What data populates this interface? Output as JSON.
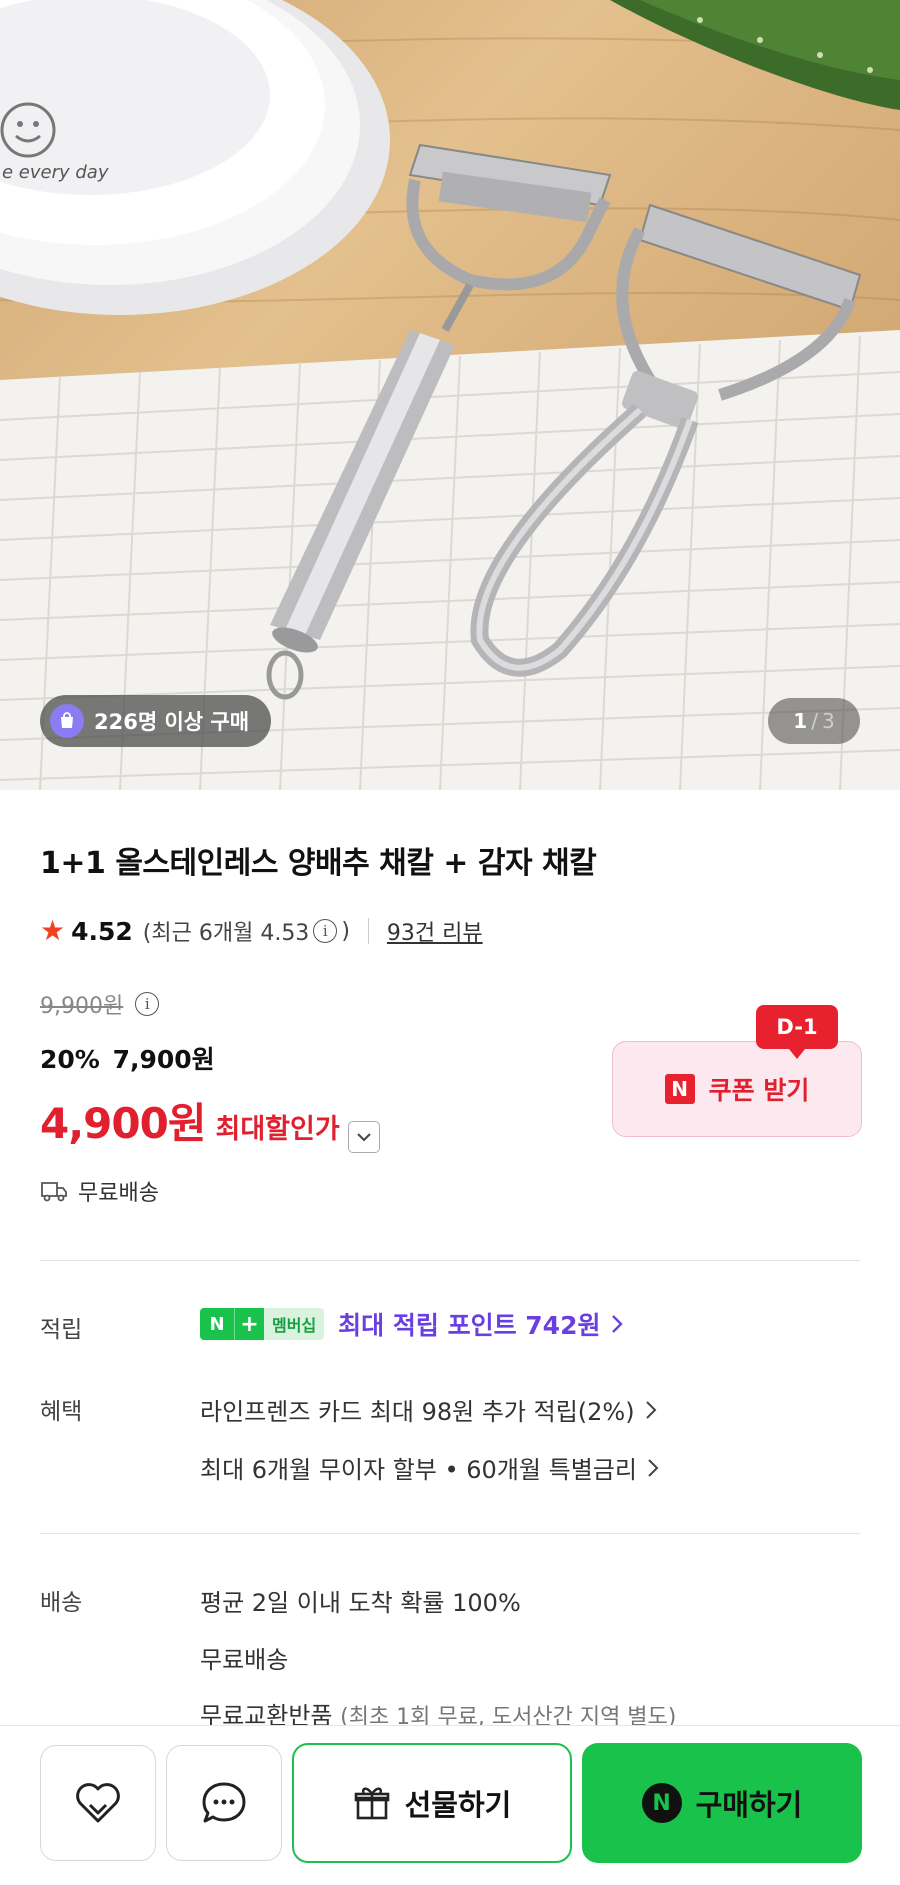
{
  "hero": {
    "plate_text": "e every day",
    "buyers_badge": "226명 이상 구매",
    "image_index": "1",
    "image_separator": "/",
    "image_total": "3"
  },
  "product": {
    "title": "1+1 올스테인레스 양배추 채칼 + 감자 채칼",
    "rating": "4.52",
    "recent_rating": "(최근 6개월 4.53",
    "recent_close": ")",
    "review_count": "93건 리뷰",
    "original_price": "9,900원",
    "discount_percent": "20%",
    "sale_price": "7,900원",
    "best_price": "4,900원",
    "best_price_label": "최대할인가",
    "shipping": "무료배송"
  },
  "coupon": {
    "dday": "D-1",
    "n_mark": "N",
    "label": "쿠폰 받기"
  },
  "points": {
    "label": "적립",
    "badge_n": "N",
    "badge_plus": "+",
    "badge_membership": "멤버십",
    "text": "최대 적립 포인트 742원"
  },
  "benefits": {
    "label": "혜택",
    "items": [
      "라인프렌즈 카드 최대 98원 추가 적립(2%)",
      "최대 6개월 무이자 할부 • 60개월 특별금리"
    ]
  },
  "delivery": {
    "label": "배송",
    "lines": [
      "평균 2일 이내 도착 확률 100%",
      "무료배송"
    ],
    "exchange_main": "무료교환반품",
    "exchange_sub": "(최초 1회 무료, 도서산간 지역 별도)"
  },
  "bottom_bar": {
    "gift_label": "선물하기",
    "buy_n": "N",
    "buy_label": "구매하기"
  },
  "colors": {
    "accent_red": "#e0202f",
    "naver_green": "#19c24b",
    "points_purple": "#6a3fe0"
  }
}
